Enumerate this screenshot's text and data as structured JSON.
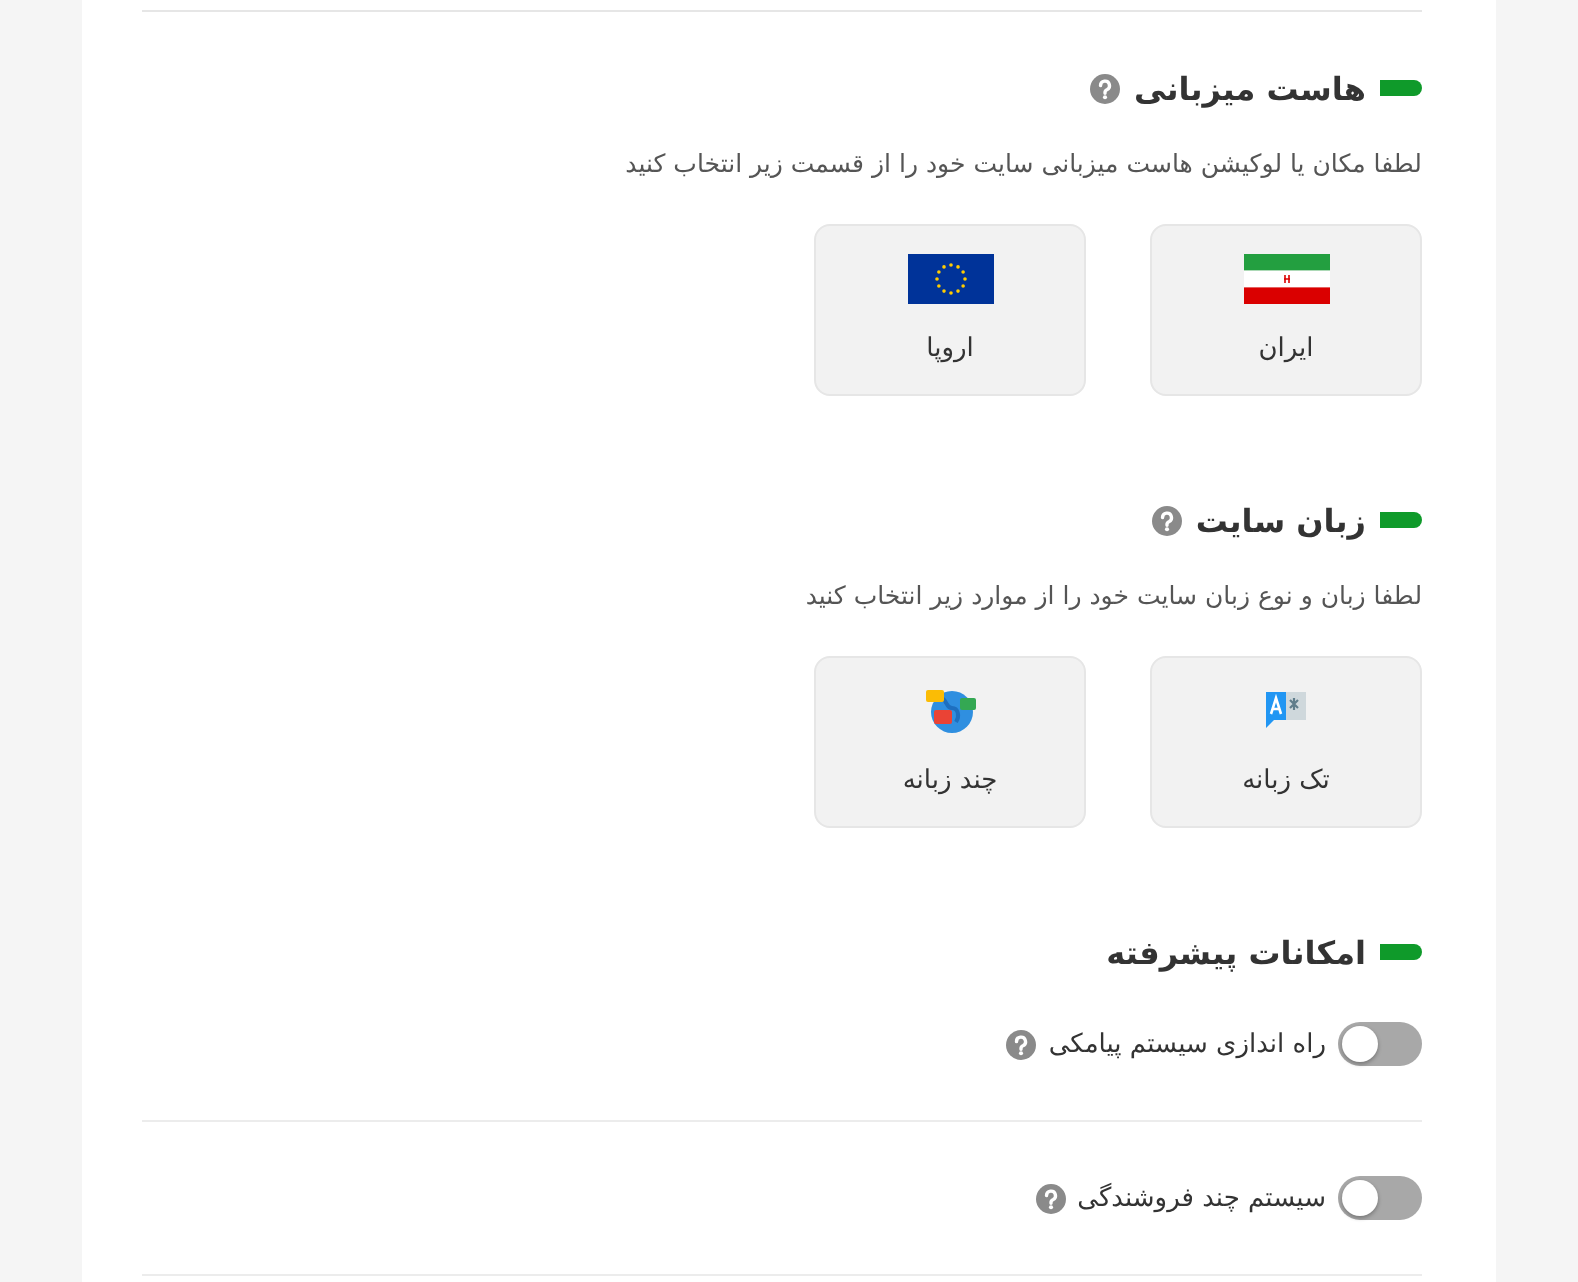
{
  "sections": [
    {
      "kind": "options",
      "title": "هاست میزبانی",
      "help": true,
      "description": "لطفا مکان یا لوکیشن هاست میزبانی سایت خود را از قسمت زیر انتخاب کنید",
      "options": [
        {
          "label": "ایران"
        },
        {
          "label": "اروپا"
        }
      ]
    },
    {
      "kind": "options",
      "title": "زبان سایت",
      "help": true,
      "description": "لطفا زبان و نوع زبان سایت خود را از موارد زیر انتخاب کنید",
      "options": [
        {
          "label": "تک زبانه"
        },
        {
          "label": "چند زبانه"
        }
      ]
    },
    {
      "kind": "toggles",
      "title": "امکانات پیشرفته",
      "help": false,
      "toggles": [
        {
          "label": "راه اندازی سیستم پیامکی",
          "help": true,
          "on": false
        },
        {
          "label": "سیستم چند فروشندگی",
          "help": true,
          "on": false
        }
      ]
    }
  ]
}
